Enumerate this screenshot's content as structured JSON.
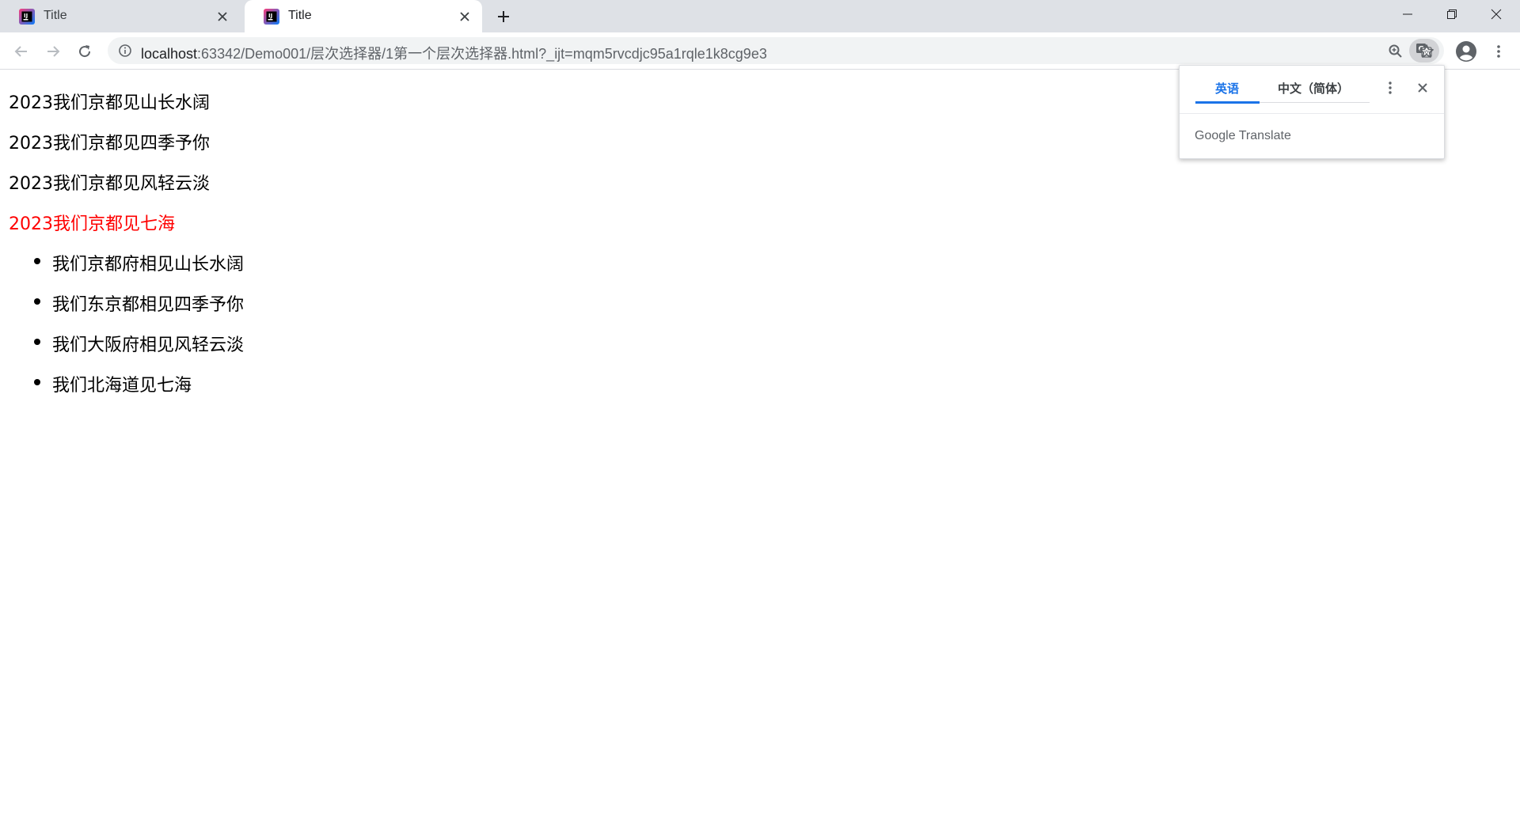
{
  "browser": {
    "tabs": [
      {
        "title": "Title",
        "active": false
      },
      {
        "title": "Title",
        "active": true
      }
    ],
    "address": {
      "host": "localhost",
      "rest": ":63342/Demo001/层次选择器/1第一个层次选择器.html?_ijt=mqm5rvcdjc95a1rqle1k8cg9e3"
    },
    "icons": {
      "favicon": "intellij-icon",
      "back": "arrow-left-icon",
      "forward": "arrow-right-icon",
      "reload": "reload-icon",
      "info": "info-icon",
      "translate": "translate-icon",
      "zoom": "zoom-icon",
      "bookmark": "star-icon",
      "profile": "account-icon",
      "menu": "more-vert-icon"
    }
  },
  "page": {
    "paragraphs": [
      {
        "text": "2023我们京都见山长水阔",
        "color": "#000000"
      },
      {
        "text": "2023我们京都见四季予你",
        "color": "#000000"
      },
      {
        "text": "2023我们京都见风轻云淡",
        "color": "#000000"
      },
      {
        "text": "2023我们京都见七海",
        "color": "#ff0000"
      }
    ],
    "list": [
      "我们京都府相见山长水阔",
      "我们东京都相见四季予你",
      "我们大阪府相见风轻云淡",
      "我们北海道见七海"
    ]
  },
  "translate_popup": {
    "source_lang": "英语",
    "target_lang": "中文（简体）",
    "brand_google": "Google",
    "brand_translate": "Translate",
    "accent": "#1a73e8"
  }
}
